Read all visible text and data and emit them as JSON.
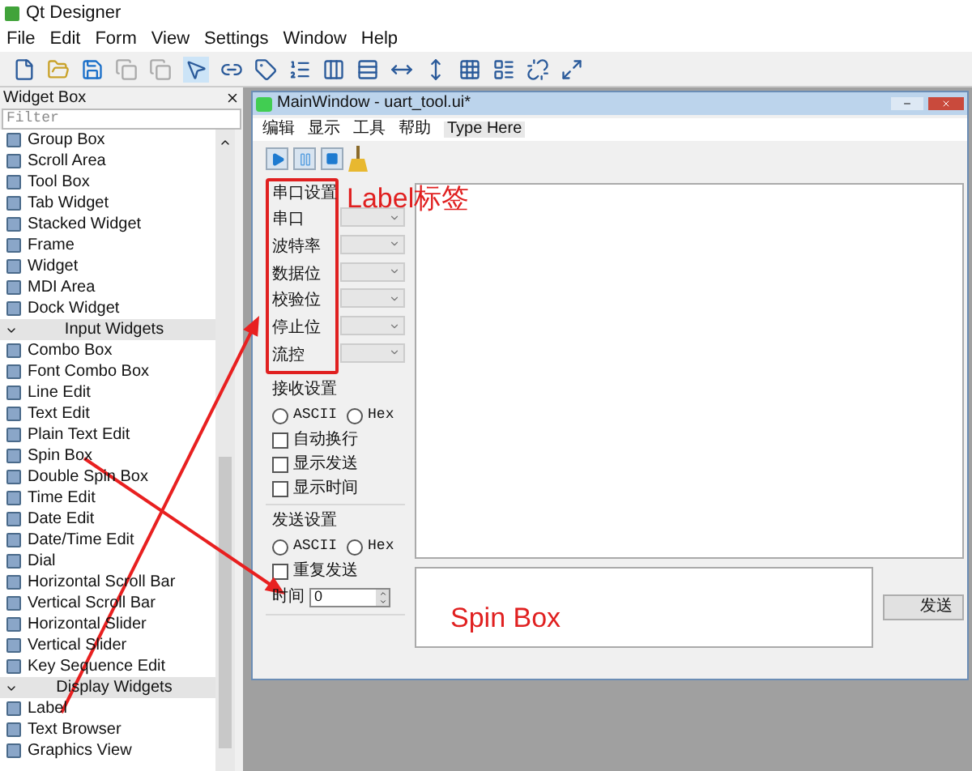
{
  "window": {
    "title": "Qt Designer"
  },
  "menu": [
    "File",
    "Edit",
    "Form",
    "View",
    "Settings",
    "Window",
    "Help"
  ],
  "widget_box": {
    "title": "Widget Box",
    "filter": {
      "placeholder": "Filter"
    },
    "items": [
      {
        "kind": "item",
        "label": "Group Box"
      },
      {
        "kind": "item",
        "label": "Scroll Area"
      },
      {
        "kind": "item",
        "label": "Tool Box"
      },
      {
        "kind": "item",
        "label": "Tab Widget"
      },
      {
        "kind": "item",
        "label": "Stacked Widget"
      },
      {
        "kind": "item",
        "label": "Frame"
      },
      {
        "kind": "item",
        "label": "Widget"
      },
      {
        "kind": "item",
        "label": "MDI Area"
      },
      {
        "kind": "item",
        "label": "Dock Widget"
      },
      {
        "kind": "category",
        "label": "Input Widgets",
        "expanded": true
      },
      {
        "kind": "item",
        "label": "Combo Box"
      },
      {
        "kind": "item",
        "label": "Font Combo Box"
      },
      {
        "kind": "item",
        "label": "Line Edit"
      },
      {
        "kind": "item",
        "label": "Text Edit"
      },
      {
        "kind": "item",
        "label": "Plain Text Edit"
      },
      {
        "kind": "item",
        "label": "Spin Box"
      },
      {
        "kind": "item",
        "label": "Double Spin Box"
      },
      {
        "kind": "item",
        "label": "Time Edit"
      },
      {
        "kind": "item",
        "label": "Date Edit"
      },
      {
        "kind": "item",
        "label": "Date/Time Edit"
      },
      {
        "kind": "item",
        "label": "Dial"
      },
      {
        "kind": "item",
        "label": "Horizontal Scroll Bar"
      },
      {
        "kind": "item",
        "label": "Vertical Scroll Bar"
      },
      {
        "kind": "item",
        "label": "Horizontal Slider"
      },
      {
        "kind": "item",
        "label": "Vertical Slider"
      },
      {
        "kind": "item",
        "label": "Key Sequence Edit"
      },
      {
        "kind": "category",
        "label": "Display Widgets",
        "expanded": true
      },
      {
        "kind": "item",
        "label": "Label"
      },
      {
        "kind": "item",
        "label": "Text Browser"
      },
      {
        "kind": "item",
        "label": "Graphics View"
      }
    ]
  },
  "form": {
    "title": "MainWindow - uart_tool.ui*",
    "menu": [
      {
        "kind": "menu",
        "label": "编辑"
      },
      {
        "kind": "menu",
        "label": "显示"
      },
      {
        "kind": "menu",
        "label": "工具"
      },
      {
        "kind": "menu",
        "label": "帮助"
      },
      {
        "kind": "new-entry",
        "label": "Type Here"
      }
    ],
    "serial": {
      "title": "串口设置",
      "labels": [
        "串口",
        "波特率",
        "数据位",
        "校验位",
        "停止位",
        "流控"
      ]
    },
    "receive": {
      "title": "接收设置",
      "radios": [
        {
          "label": "ASCII",
          "selected": false
        },
        {
          "label": "Hex",
          "selected": false
        }
      ],
      "checks": [
        {
          "label": "自动换行",
          "checked": false
        },
        {
          "label": "显示发送",
          "checked": false
        },
        {
          "label": "显示时间",
          "checked": false
        }
      ]
    },
    "send": {
      "title": "发送设置",
      "radios": [
        {
          "label": "ASCII",
          "selected": false
        },
        {
          "label": "Hex",
          "selected": false
        }
      ],
      "checks": [
        {
          "label": "重复发送",
          "checked": false
        }
      ],
      "spin": {
        "label": "时间",
        "value": "0"
      }
    },
    "send_button": "发送"
  },
  "annotations": {
    "label_note": "Label标签",
    "spin_note": "Spin Box"
  }
}
